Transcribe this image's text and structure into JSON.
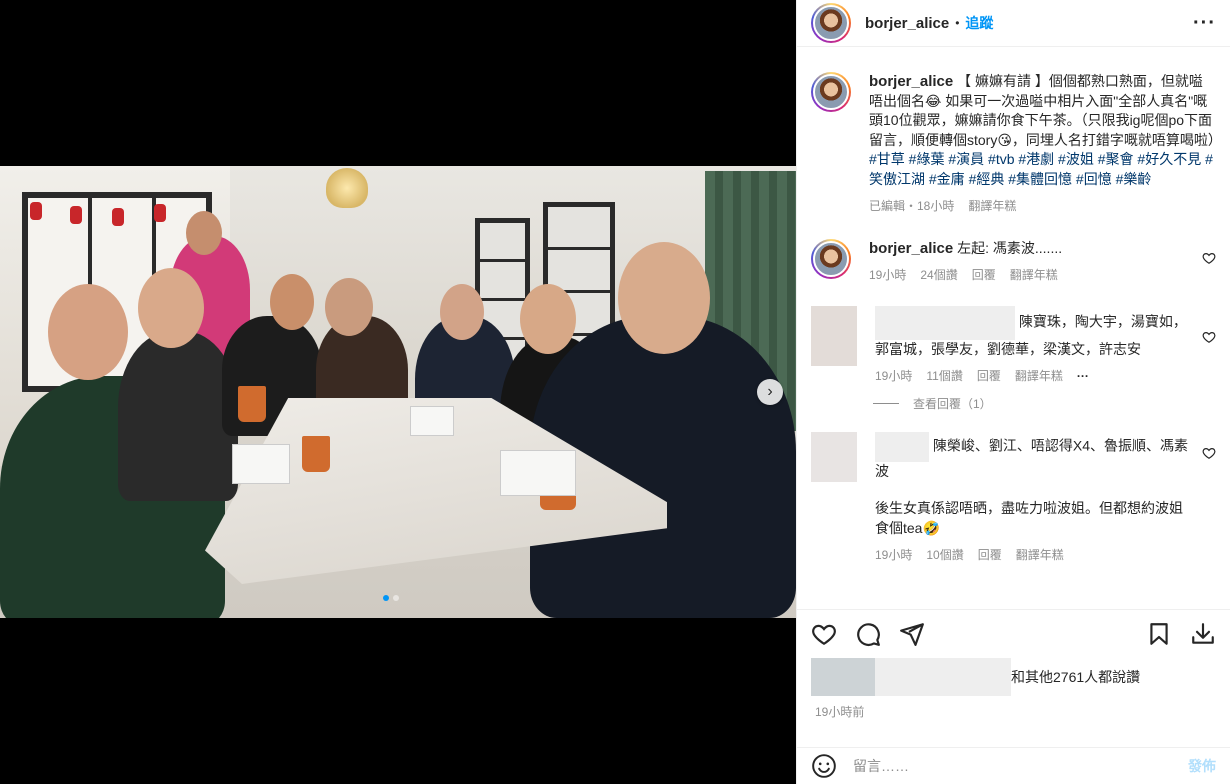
{
  "post": {
    "username": "borjer_alice",
    "separator": "•",
    "follow_label": "追蹤",
    "more_label": "···",
    "caption_text": "【 嫲嫲有請 】個個都熟口熟面，但就嗌唔出個名😂 如果可一次過嗌中相片入面\"全部人真名\"嘅頭10位觀眾，嫲嫲請你食下午茶。（只限我ig呢個po下面留言，順便轉個story😘，同埋人名打錯字嘅就唔算喝啦）",
    "caption_tags": "#甘草 #綠葉 #演員 #tvb #港劇 #波姐 #聚會 #好久不見 #笑傲江湖 #金庸 #經典 #集體回憶 #回憶 #樂齡",
    "caption_meta": {
      "edited": "已編輯・18小時",
      "translate": "翻譯年糕"
    }
  },
  "comments": [
    {
      "username": "borjer_alice",
      "text": "左起: 馮素波.......",
      "time": "19小時",
      "likes": "24個讚",
      "reply": "回覆",
      "translate": "翻譯年糕"
    },
    {
      "text": "陳寶珠，陶大宇，湯寶如，郭富城，張學友，劉德華，梁漢文，許志安",
      "time": "19小時",
      "likes": "11個讚",
      "reply": "回覆",
      "translate": "翻譯年糕",
      "more": "···",
      "view_replies": "查看回覆（1）"
    },
    {
      "text": "陳榮峻、劉江、唔認得X4、魯振順、馮素波",
      "text2": "後生女真係認唔晒，盡咗力啦波姐。但都想約波姐食個tea🤣",
      "time": "19小時",
      "likes": "10個讚",
      "reply": "回覆",
      "translate": "翻譯年糕"
    }
  ],
  "likes_text": "和其他2761人都說讚",
  "post_time": "19小時前",
  "comment_box": {
    "placeholder": "留言……",
    "post_label": "發佈"
  },
  "carousel": {
    "next": "›",
    "count": 2,
    "active_index": 0
  },
  "colors": {
    "link": "#0095f6",
    "hashtag": "#00376b",
    "muted": "#8e8e8e"
  }
}
